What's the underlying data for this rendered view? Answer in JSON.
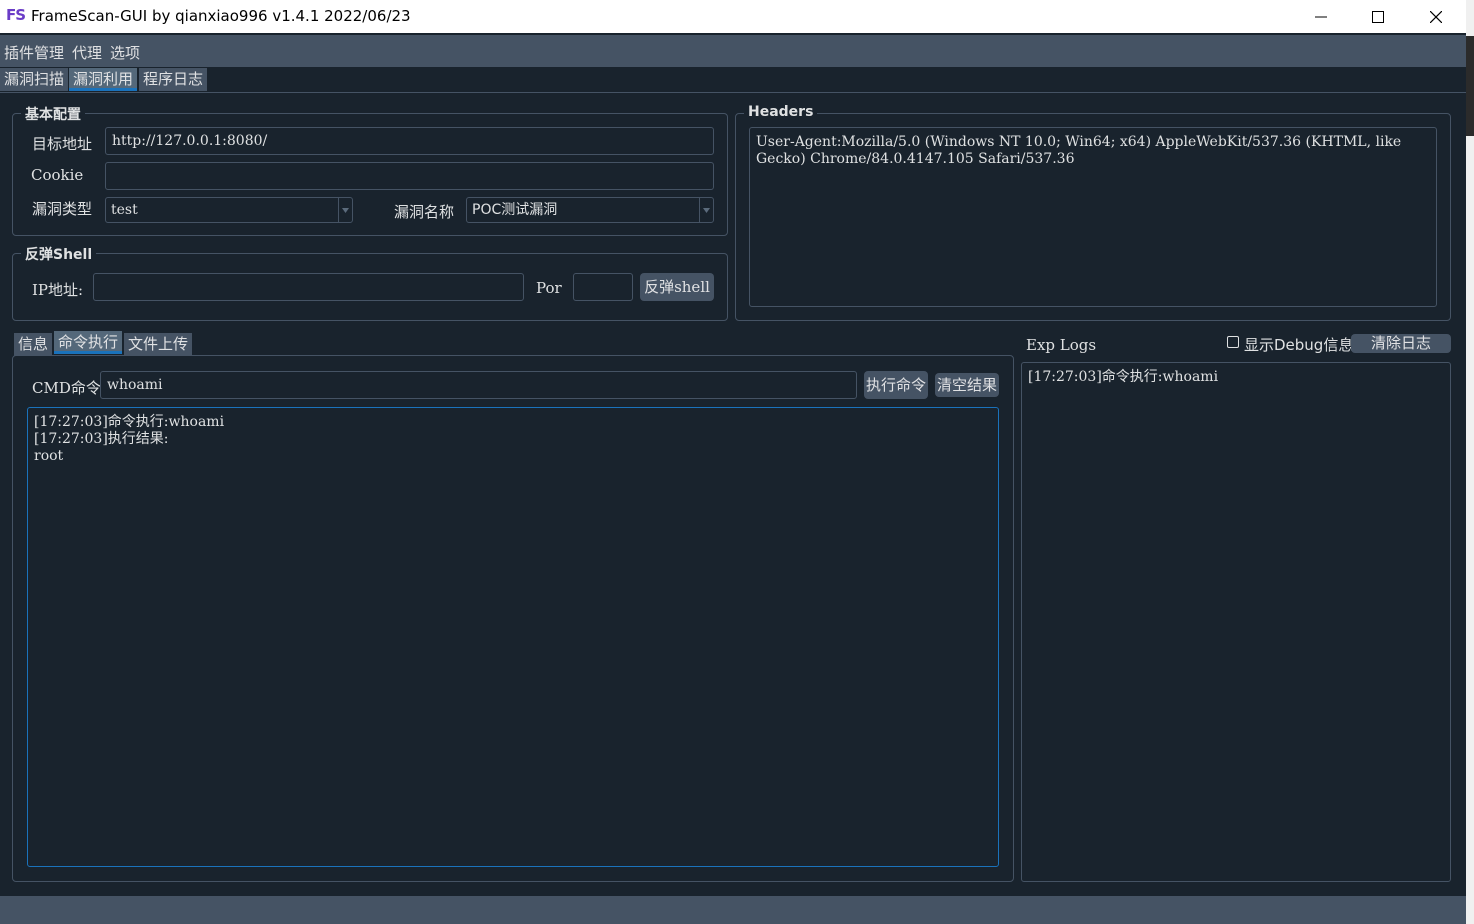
{
  "window": {
    "icon_text": "FS",
    "title": "FrameScan-GUI  by qianxiao996 v1.4.1 2022/06/23"
  },
  "menu": [
    "插件管理",
    "代理",
    "选项"
  ],
  "main_tabs": [
    "漏洞扫描",
    "漏洞利用",
    "程序日志"
  ],
  "basic_config": {
    "title": "基本配置",
    "target_label": "目标地址",
    "target_value": "http://127.0.0.1:8080/",
    "cookie_label": "Cookie",
    "cookie_value": "",
    "vuln_type_label": "漏洞类型",
    "vuln_type_value": "test",
    "vuln_name_label": "漏洞名称",
    "vuln_name_value": "POC测试漏洞"
  },
  "reverse_shell": {
    "title": "反弹Shell",
    "ip_label": "IP地址:",
    "ip_value": "",
    "port_label": "Por",
    "port_value": "",
    "button": "反弹shell"
  },
  "headers": {
    "title": "Headers",
    "text": "User-Agent:Mozilla/5.0 (Windows NT 10.0; Win64; x64) AppleWebKit/537.36 (KHTML, like Gecko) Chrome/84.0.4147.105 Safari/537.36"
  },
  "sub_tabs": [
    "信息",
    "命令执行",
    "文件上传"
  ],
  "command": {
    "label": "CMD命令",
    "value": "whoami",
    "exec_button": "执行命令",
    "clear_button": "清空结果",
    "output": "[17:27:03]命令执行:whoami\n[17:27:03]执行结果:\nroot"
  },
  "exp_logs": {
    "title": "Exp Logs",
    "debug_checkbox_label": "显示Debug信息",
    "debug_checked": false,
    "clear_button": "清除日志",
    "log": "[17:27:03]命令执行:whoami"
  },
  "colors": {
    "background": "#19232d",
    "panel": "#455364",
    "accent": "#1a72bb",
    "text": "#dfe1e2"
  }
}
